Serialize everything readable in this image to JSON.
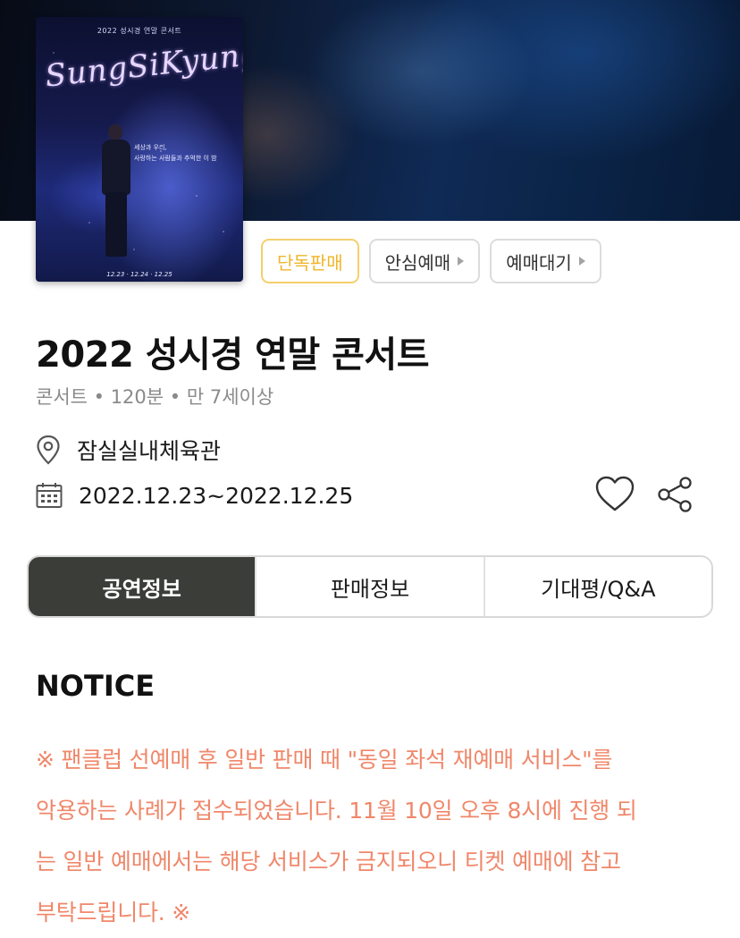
{
  "poster": {
    "top_text": "2022 성시경 연말 콘서트",
    "script_title": "SungSiKyung",
    "lyric_line1": "세상과 우리,",
    "lyric_line2": "사랑하는 사람들과 추억한 이 밤",
    "dates": "12.23 · 12.24 · 12.25"
  },
  "chips": [
    {
      "label": "단독판매",
      "has_arrow": false
    },
    {
      "label": "안심예매",
      "has_arrow": true
    },
    {
      "label": "예매대기",
      "has_arrow": true
    }
  ],
  "title": "2022 성시경 연말 콘서트",
  "meta": "콘서트 • 120분 • 만 7세이상",
  "venue": "잠실실내체육관",
  "date_range": "2022.12.23~2022.12.25",
  "actions": {
    "like_icon": "heart-icon",
    "share_icon": "share-icon"
  },
  "tabs": [
    {
      "label": "공연정보",
      "active": true
    },
    {
      "label": "판매정보",
      "active": false
    },
    {
      "label": "기대평/Q&A",
      "active": false
    }
  ],
  "notice": {
    "title": "NOTICE",
    "lines": [
      "※ 팬클럽 선예매 후 일반 판매 때 \"동일 좌석 재예매 서비스\"를",
      "악용하는 사례가 접수되었습니다. 11월 10일 오후 8시에 진행 되",
      "는 일반 예매에서는 해당 서비스가 금지되오니 티켓 예매에 참고",
      "부탁드립니다. ※"
    ],
    "color": "#f0876a"
  },
  "colors": {
    "exclusive_chip": "#f0b52a",
    "active_tab_bg": "#3b3d39"
  }
}
